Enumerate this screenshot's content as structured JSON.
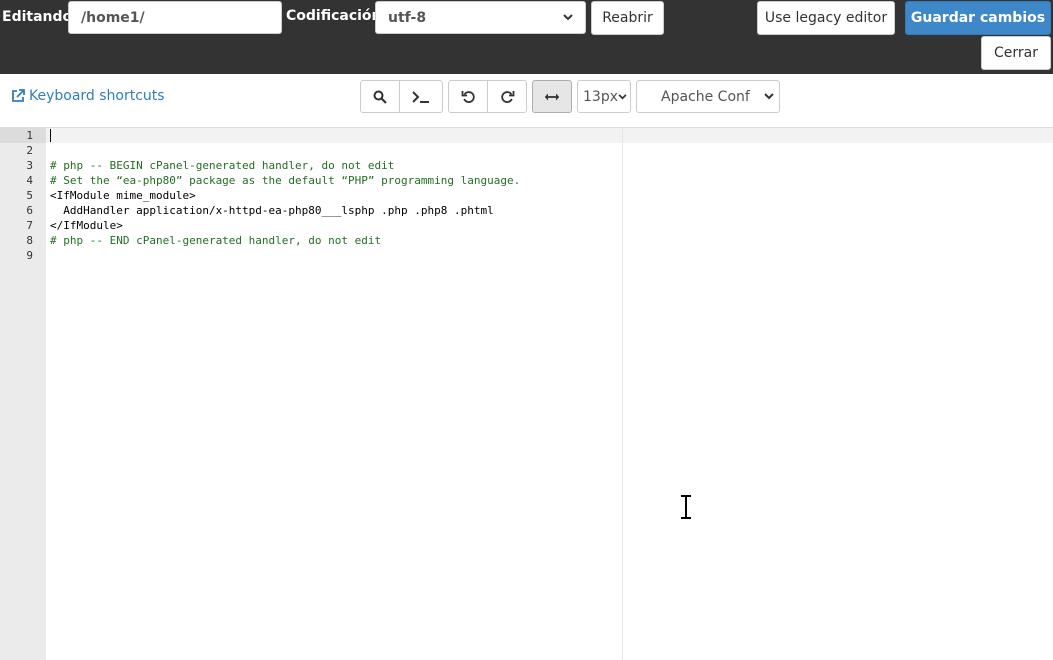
{
  "header": {
    "editing_label": "Editando:",
    "path_value": "/home1/",
    "encoding_label": "Codificación",
    "encoding_value": "utf-8",
    "reopen_label": "Reabrir",
    "legacy_label": "Use legacy editor",
    "save_label": "Guardar cambios",
    "close_label": "Cerrar",
    "colors": {
      "bar": "#333333",
      "primary": "#3e87c8"
    }
  },
  "toolbar": {
    "keyboard_shortcuts": "Keyboard shortcuts",
    "font_size": "13px",
    "mode": "Apache Conf",
    "icons": [
      "search-icon",
      "terminal-icon",
      "undo-icon",
      "redo-icon",
      "wrap-toggle-icon"
    ]
  },
  "editor": {
    "line_numbers": [
      "1",
      "2",
      "3",
      "4",
      "5",
      "6",
      "7",
      "8",
      "9"
    ],
    "lines": [
      "",
      "",
      "# php -- BEGIN cPanel-generated handler, do not edit",
      "# Set the “ea-php80” package as the default “PHP” programming language.",
      "<IfModule mime_module>",
      "  AddHandler application/x-httpd-ea-php80___lsphp .php .php8 .phtml",
      "</IfModule>",
      "# php -- END cPanel-generated handler, do not edit",
      ""
    ]
  }
}
